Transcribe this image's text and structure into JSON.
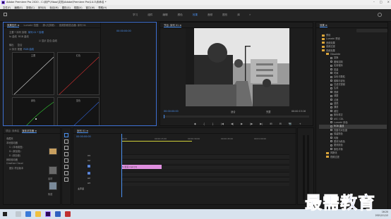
{
  "window": {
    "title": "Adobe Premiere Pro 2020 - C:\\用户\\Yibao\\文档\\Adobe\\Premiere Pro\\14.0\\未命名 *"
  },
  "menu": [
    "文件(F)",
    "编辑(E)",
    "剪辑(C)",
    "序列(S)",
    "标记(M)",
    "图形(G)",
    "视图(V)",
    "窗口(W)",
    "帮助(H)"
  ],
  "workspaces": [
    "学习",
    "组件",
    "编辑",
    "颜色",
    "效果",
    "音频",
    "图形",
    "库"
  ],
  "workspace_active": "效果",
  "effect_controls": {
    "tabs": [
      "效果控件 ≡",
      "Lumetri 范围",
      "源:(无剪辑)",
      "音频剪辑混合器: 序列 01"
    ],
    "rows": [
      {
        "label": "主要 * 序列 剪辑",
        "value": "序列 01 * 剪辑"
      },
      {
        "label": "fx 曲线",
        "value": "RGB 曲线"
      },
      {
        "label": "",
        "value": "☑ 显示 复合 曲线"
      },
      {
        "label": "输出",
        "value": "复合"
      },
      {
        "label": "☑ 拆分 视图",
        "value": "RGB 曲线"
      }
    ],
    "curve_labels": [
      "主要",
      "红色",
      "绿色",
      "蓝色"
    ],
    "mini_timecode": "00:00:00:00"
  },
  "program_monitor": {
    "tab": "节目: 序列 01 ≡",
    "current_time": "00:00:00:00",
    "fit": "适合",
    "quality": "完整",
    "duration": "00:00:15:16",
    "transport": [
      "◆",
      "{",
      "}",
      "|◀",
      "◀|",
      "▶",
      "|▶",
      "▶|",
      "⊞",
      "⊟",
      "📷",
      "+"
    ]
  },
  "effects_panel": {
    "tab": "效果 ≡",
    "items": [
      {
        "type": "folder",
        "label": "预设"
      },
      {
        "type": "folder",
        "label": "Lumetri 预设"
      },
      {
        "type": "folder",
        "label": "音频效果"
      },
      {
        "type": "folder",
        "label": "音频过渡"
      },
      {
        "type": "folder",
        "label": "视频效果"
      },
      {
        "type": "folder",
        "label": "Obsolete"
      },
      {
        "type": "fx",
        "label": "变换"
      },
      {
        "type": "fx",
        "label": "图像控制"
      },
      {
        "type": "fx",
        "label": "实用程序"
      },
      {
        "type": "fx",
        "label": "扭曲"
      },
      {
        "type": "fx",
        "label": "时间"
      },
      {
        "type": "fx",
        "label": "杂色与颗粒"
      },
      {
        "type": "fx",
        "label": "模糊与锐化"
      },
      {
        "type": "fx",
        "label": "沉浸式视频"
      },
      {
        "type": "fx",
        "label": "生成"
      },
      {
        "type": "fx",
        "label": "视频"
      },
      {
        "type": "fx",
        "label": "调整"
      },
      {
        "type": "fx",
        "label": "过渡"
      },
      {
        "type": "fx",
        "label": "透视"
      },
      {
        "type": "fx",
        "label": "通道"
      },
      {
        "type": "fx",
        "label": "键控"
      },
      {
        "type": "fx",
        "label": "颜色校正"
      },
      {
        "type": "fx",
        "label": "ASC CDL"
      },
      {
        "type": "fx",
        "label": "Lumetri 颜色"
      },
      {
        "type": "fx",
        "label": "RGB 曲线",
        "selected": true
      },
      {
        "type": "fx",
        "label": "亮度与对比度"
      },
      {
        "type": "fx",
        "label": "保留颜色"
      },
      {
        "type": "fx",
        "label": "均衡"
      },
      {
        "type": "fx",
        "label": "更改为颜色"
      },
      {
        "type": "fx",
        "label": "更改颜色"
      },
      {
        "type": "fx",
        "label": "颜色平衡"
      },
      {
        "type": "folder",
        "label": "风格化"
      },
      {
        "type": "folder",
        "label": "视频过渡"
      }
    ]
  },
  "project_panel": {
    "tabs": [
      "项目: 未命名",
      "媒体浏览器 ≡"
    ],
    "items": [
      "收藏夹",
      "本地驱动器",
      "C: (本地磁盘)",
      "D: (新加卷)",
      "E: (新加卷)",
      "网络驱动器",
      "Creative Cloud",
      "团队 项目版本"
    ],
    "thumbs": [
      "素材",
      "街道"
    ]
  },
  "timeline": {
    "tab": "序列 01 ≡",
    "timecode": "00:00:00:00",
    "ruler": [
      "00:00",
      "00:00:15:00",
      "00:00:30:00",
      "00:00:45:00",
      "00:01:00:00"
    ],
    "tracks": [
      "V3",
      "V2",
      "V1",
      "A1",
      "A2",
      "A3",
      "主声道"
    ],
    "clip_label": "fx 街道.mp4 [V]"
  },
  "taskbar": {
    "time": "16:20",
    "date": "2021/11/12"
  },
  "watermark": "最需教育",
  "colors": {
    "accent": "#4a90f0",
    "clip": "#e08fe0",
    "folder": "#d9a43a",
    "watermark": "#1030c0"
  }
}
